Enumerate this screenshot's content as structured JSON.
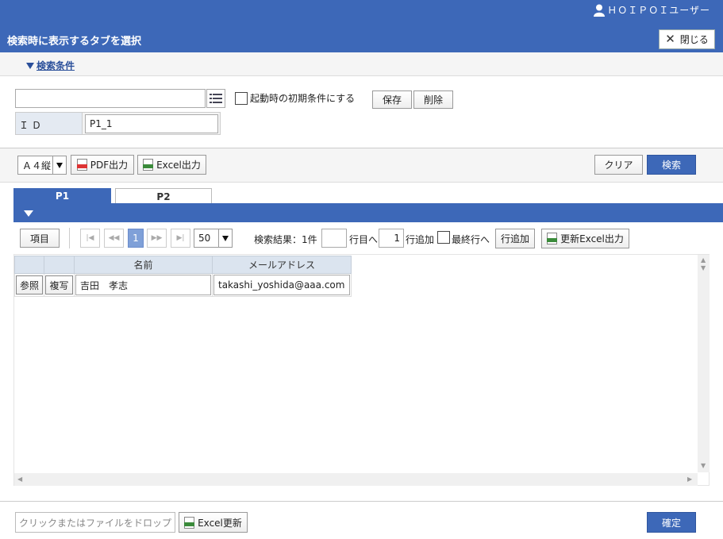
{
  "header": {
    "user_name": "ＨＯＩＰＯＩユーザー",
    "title": "検索時に表示するタブを選択",
    "close_label": "閉じる"
  },
  "conditions": {
    "toggle_label": "検索条件",
    "search_value": "",
    "initial_condition_label": "起動時の初期条件にする",
    "save_label": "保存",
    "delete_label": "削除",
    "id_label": "ＩＤ",
    "id_value": "P1_1"
  },
  "toolbar": {
    "paper_size": "Ａ４縦",
    "pdf_label": "PDF出力",
    "excel_label": "Excel出力",
    "clear_label": "クリア",
    "search_label": "検索"
  },
  "tabs": [
    {
      "label": "P1",
      "active": true
    },
    {
      "label": "P2",
      "active": false
    }
  ],
  "pager": {
    "items_label": "項目",
    "first": "|◀",
    "prev": "◀◀",
    "current_page": "1",
    "next": "▶▶",
    "last": "▶|",
    "page_size": "50",
    "result_label": "検索結果：1件",
    "goto_row_value": "",
    "goto_row_label": "行目へ",
    "add_count_value": "1",
    "add_row_label": "行追加",
    "last_row_label": "最終行へ",
    "add_row_button": "行追加",
    "update_excel_label": "更新Excel出力"
  },
  "grid": {
    "columns": [
      "",
      "",
      "名前",
      "メールアドレス"
    ],
    "rows": [
      {
        "ref_label": "参照",
        "copy_label": "複写",
        "name": "吉田　孝志",
        "email": "takashi_yoshida@aaa.com"
      }
    ]
  },
  "footer": {
    "dropzone_label": "クリックまたはファイルをドロップ",
    "excel_update_label": "Excel更新",
    "confirm_label": "確定"
  },
  "colors": {
    "primary": "#3d68b8",
    "header_cell": "#dbe4ef"
  }
}
